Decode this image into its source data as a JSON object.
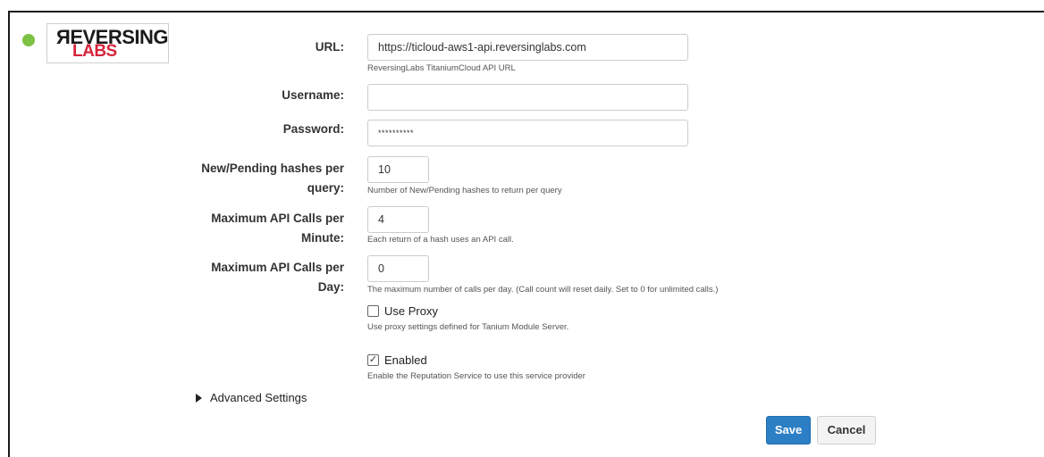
{
  "provider": {
    "logo_top": "ЯEVERSING",
    "logo_bottom": "LABS",
    "status_color": "#7cc243"
  },
  "form": {
    "url": {
      "label": "URL:",
      "value": "https://ticloud-aws1-api.reversinglabs.com",
      "help": "ReversingLabs TitaniumCloud API URL"
    },
    "username": {
      "label": "Username:",
      "value": ""
    },
    "password": {
      "label": "Password:",
      "value": "**********"
    },
    "hashes_per_query": {
      "label_line1": "New/Pending hashes per",
      "label_line2": "query:",
      "value": "10",
      "help": "Number of New/Pending hashes to return per query"
    },
    "calls_per_minute": {
      "label_line1": "Maximum API Calls per",
      "label_line2": "Minute:",
      "value": "4",
      "help": "Each return of a hash uses an API call."
    },
    "calls_per_day": {
      "label_line1": "Maximum API Calls per",
      "label_line2": "Day:",
      "value": "0",
      "help": "The maximum number of calls per day. (Call count will reset daily. Set to 0 for unlimited calls.)"
    },
    "use_proxy": {
      "label": "Use Proxy",
      "checked": false,
      "help": "Use proxy settings defined for Tanium Module Server."
    },
    "enabled": {
      "label": "Enabled",
      "checked": true,
      "help": "Enable the Reputation Service to use this service provider"
    },
    "advanced": {
      "label": "Advanced Settings"
    }
  },
  "actions": {
    "save_label": "Save",
    "cancel_label": "Cancel",
    "save_color": "#2c7fc5"
  }
}
